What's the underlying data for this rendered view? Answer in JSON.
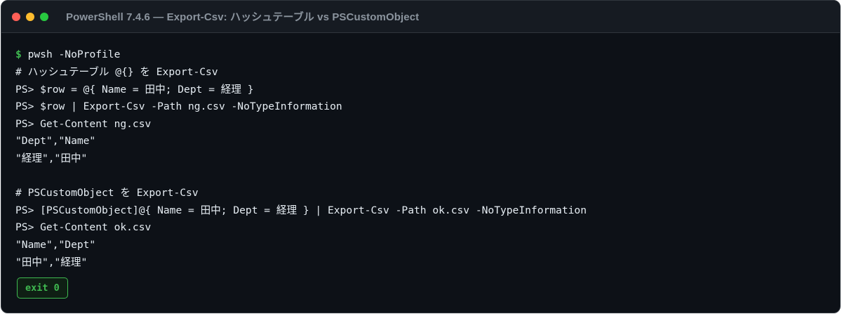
{
  "window": {
    "title": "PowerShell 7.4.6 — Export-Csv: ハッシュテーブル vs PSCustomObject"
  },
  "terminal": {
    "prompt_symbol": "$",
    "command": " pwsh -NoProfile",
    "lines": [
      "# ハッシュテーブル @{} を Export-Csv",
      "PS> $row = @{ Name = 田中; Dept = 経理 }",
      "PS> $row | Export-Csv -Path ng.csv -NoTypeInformation",
      "PS> Get-Content ng.csv",
      "\"Dept\",\"Name\"",
      "\"経理\",\"田中\"",
      "",
      "# PSCustomObject を Export-Csv",
      "PS> [PSCustomObject]@{ Name = 田中; Dept = 経理 } | Export-Csv -Path ok.csv -NoTypeInformation",
      "PS> Get-Content ok.csv",
      "\"Name\",\"Dept\"",
      "\"田中\",\"経理\""
    ]
  },
  "status": {
    "exit_label": "exit 0"
  },
  "colors": {
    "background": "#0d1117",
    "titlebar": "#161b22",
    "text": "#e6edf3",
    "accent_green": "#3fb950",
    "title_text": "#8b949e"
  }
}
